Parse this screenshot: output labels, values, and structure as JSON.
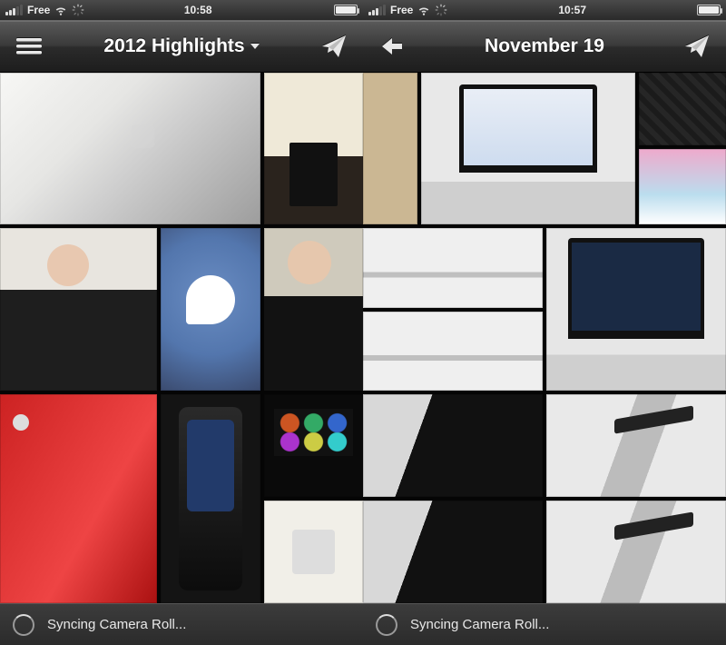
{
  "left": {
    "status": {
      "carrier": "Free",
      "time": "10:58",
      "battery_pct": 92
    },
    "nav": {
      "title": "2012 Highlights",
      "has_dropdown": true
    },
    "sync_label": "Syncing Camera Roll..."
  },
  "right": {
    "status": {
      "carrier": "Free",
      "time": "10:57",
      "battery_pct": 92
    },
    "nav": {
      "title": "November 19",
      "has_dropdown": false
    },
    "sync_label": "Syncing Camera Roll..."
  }
}
